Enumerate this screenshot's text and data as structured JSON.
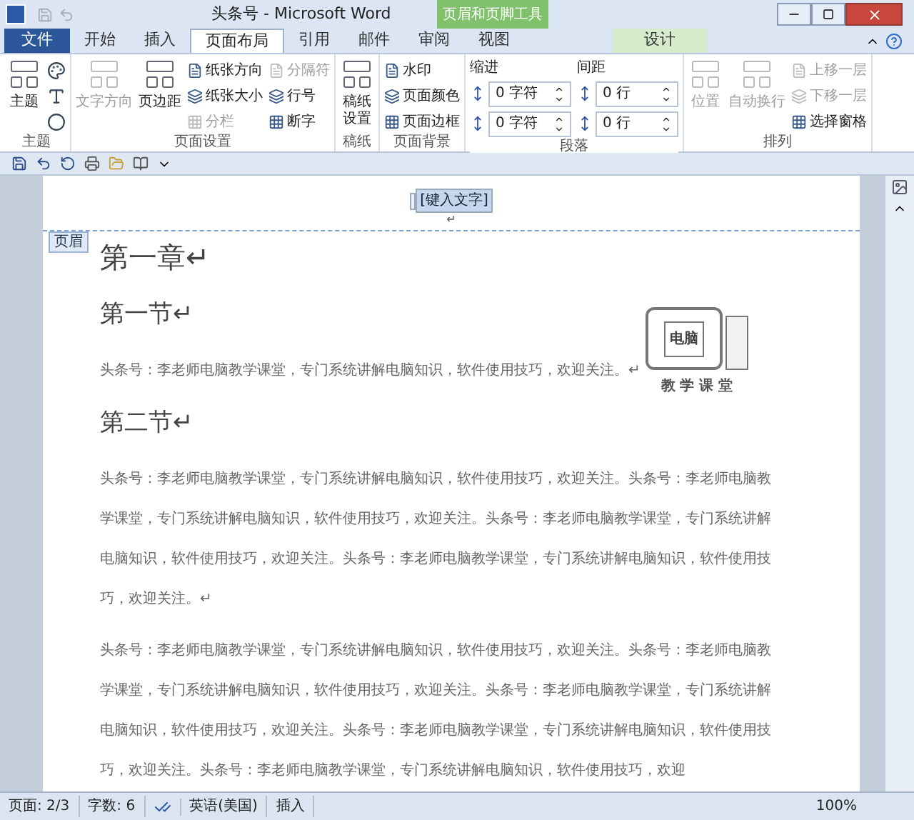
{
  "window": {
    "title": "头条号 - Microsoft Word",
    "context_tab": "页眉和页脚工具"
  },
  "tabs": [
    {
      "label": "文件",
      "kind": "file",
      "selected": false
    },
    {
      "label": "开始",
      "kind": "tab",
      "selected": false
    },
    {
      "label": "插入",
      "kind": "tab",
      "selected": false
    },
    {
      "label": "页面布局",
      "kind": "tab",
      "selected": true
    },
    {
      "label": "引用",
      "kind": "tab",
      "selected": false
    },
    {
      "label": "邮件",
      "kind": "tab",
      "selected": false
    },
    {
      "label": "审阅",
      "kind": "tab",
      "selected": false
    },
    {
      "label": "视图",
      "kind": "tab",
      "selected": false
    },
    {
      "label": "设计",
      "kind": "context",
      "selected": false
    }
  ],
  "ribbon": [
    {
      "label": "主题",
      "columns": [
        [
          {
            "kind": "large",
            "label": "主题",
            "disabled": false
          }
        ],
        [
          {
            "kind": "icon",
            "disabled": false
          },
          {
            "kind": "icon",
            "disabled": false
          },
          {
            "kind": "icon",
            "disabled": false
          }
        ]
      ]
    },
    {
      "label": "页面设置",
      "columns": [
        [
          {
            "kind": "large",
            "label": "文字方向",
            "disabled": true
          }
        ],
        [
          {
            "kind": "large",
            "label": "页边距",
            "disabled": false
          }
        ],
        [
          {
            "kind": "small",
            "label": "纸张方向",
            "disabled": false
          },
          {
            "kind": "small",
            "label": "纸张大小",
            "disabled": false
          },
          {
            "kind": "small",
            "label": "分栏",
            "disabled": true
          }
        ],
        [
          {
            "kind": "small",
            "label": "分隔符",
            "disabled": true
          },
          {
            "kind": "small",
            "label": "行号",
            "disabled": false
          },
          {
            "kind": "small",
            "label": "断字",
            "disabled": false
          }
        ]
      ]
    },
    {
      "label": "稿纸",
      "columns": [
        [
          {
            "kind": "large",
            "label": "稿纸设置",
            "disabled": false,
            "wrap": true
          }
        ]
      ]
    },
    {
      "label": "页面背景",
      "columns": [
        [
          {
            "kind": "small",
            "label": "水印",
            "disabled": false
          },
          {
            "kind": "small",
            "label": "页面颜色",
            "disabled": false
          },
          {
            "kind": "small",
            "label": "页面边框",
            "disabled": false
          }
        ]
      ]
    },
    {
      "label": "段落",
      "columns": [
        [
          {
            "kind": "heading",
            "label": "缩进",
            "disabled": false
          },
          {
            "kind": "spin",
            "label": "0 字符",
            "disabled": false
          },
          {
            "kind": "spin",
            "label": "0 字符",
            "disabled": false
          }
        ],
        [
          {
            "kind": "heading",
            "label": "间距",
            "disabled": false
          },
          {
            "kind": "spin",
            "label": "0 行",
            "disabled": false
          },
          {
            "kind": "spin",
            "label": "0 行",
            "disabled": false
          }
        ]
      ]
    },
    {
      "label": "排列",
      "columns": [
        [
          {
            "kind": "large",
            "label": "位置",
            "disabled": true
          }
        ],
        [
          {
            "kind": "large",
            "label": "自动换行",
            "disabled": true
          }
        ],
        [
          {
            "kind": "small",
            "label": "上移一层",
            "disabled": true
          },
          {
            "kind": "small",
            "label": "下移一层",
            "disabled": true
          },
          {
            "kind": "small",
            "label": "选择窗格",
            "disabled": false
          }
        ]
      ]
    }
  ],
  "header": {
    "placeholder": "[键入文字]",
    "mark": "↵",
    "tag": "页眉"
  },
  "document": [
    {
      "kind": "h1",
      "lines": [
        "第一章↵"
      ]
    },
    {
      "kind": "h2",
      "lines": [
        "第一节↵"
      ]
    },
    {
      "kind": "p",
      "lines": [
        "头条号：李老师电脑教学课堂，专门系统讲解电脑知识，软件使用技巧，欢迎关注。↵"
      ]
    },
    {
      "kind": "h2",
      "lines": [
        "第二节↵"
      ]
    },
    {
      "kind": "p",
      "lines": [
        "头条号：李老师电脑教学课堂，专门系统讲解电脑知识，软件使用技巧，欢迎关注。头条号：李老师电脑教",
        "学课堂，专门系统讲解电脑知识，软件使用技巧，欢迎关注。头条号：李老师电脑教学课堂，专门系统讲解",
        "电脑知识，软件使用技巧，欢迎关注。头条号：李老师电脑教学课堂，专门系统讲解电脑知识，软件使用技",
        "巧，欢迎关注。↵"
      ]
    },
    {
      "kind": "p",
      "lines": [
        "头条号：李老师电脑教学课堂，专门系统讲解电脑知识，软件使用技巧，欢迎关注。头条号：李老师电脑教",
        "学课堂，专门系统讲解电脑知识，软件使用技巧，欢迎关注。头条号：李老师电脑教学课堂，专门系统讲解",
        "电脑知识，软件使用技巧，欢迎关注。头条号：李老师电脑教学课堂，专门系统讲解电脑知识，软件使用技",
        "巧，欢迎关注。头条号：李老师电脑教学课堂，专门系统讲解电脑知识，软件使用技巧，欢迎"
      ]
    }
  ],
  "logo": {
    "screen": "电脑",
    "caption": "教 学 课 堂"
  },
  "status_bar": [
    {
      "label": "页面: 2/3",
      "kind": "text"
    },
    {
      "label": "字数: 6",
      "kind": "text"
    },
    {
      "kind": "proof"
    },
    {
      "label": "英语(美国)",
      "kind": "text"
    },
    {
      "label": "插入",
      "kind": "text"
    },
    {
      "label": "100%",
      "kind": "zoom"
    }
  ]
}
